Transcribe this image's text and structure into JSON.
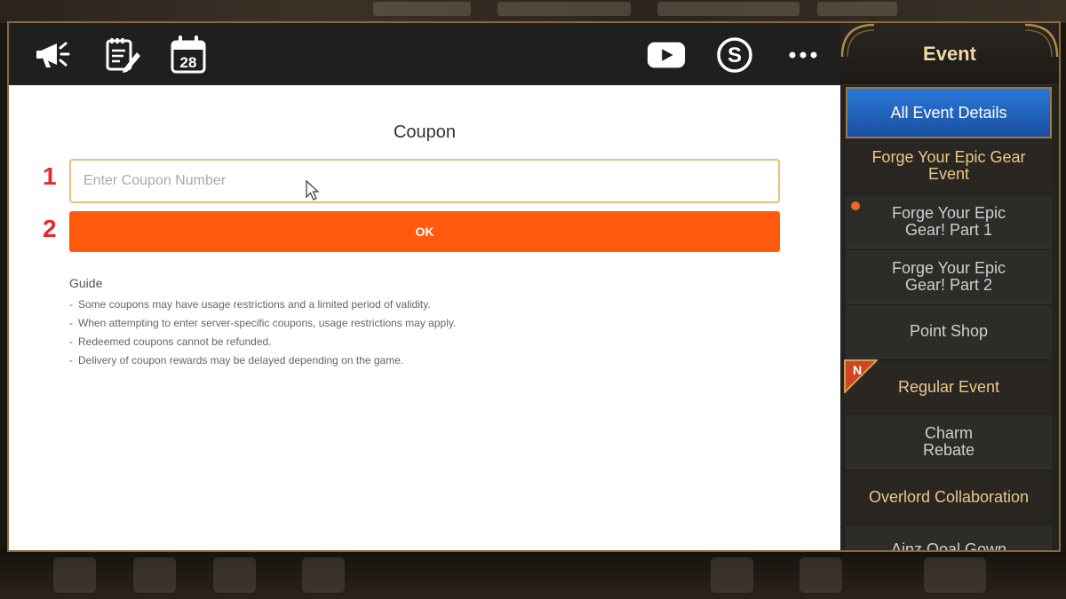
{
  "toolbar": {
    "icons": [
      "megaphone-icon",
      "notepad-icon",
      "calendar-icon",
      "youtube-icon",
      "s-logo-icon",
      "more-icon"
    ],
    "calendar_day": "28"
  },
  "coupon": {
    "title": "Coupon",
    "input_placeholder": "Enter Coupon Number",
    "input_value": "",
    "ok_label": "OK",
    "annotations": [
      "1",
      "2"
    ],
    "guide_title": "Guide",
    "guide_items": [
      "Some coupons may have usage restrictions and a limited period of validity.",
      "When attempting to enter server-specific coupons, usage restrictions may apply.",
      "Redeemed coupons cannot be refunded.",
      "Delivery of coupon rewards may be delayed depending on the game."
    ],
    "colors": {
      "ok_button": "#ff5a0e",
      "annotation": "#e5282c",
      "input_border": "#e3c27a"
    }
  },
  "sidebar": {
    "title": "Event",
    "items": [
      {
        "label": "All Event Details",
        "type": "active"
      },
      {
        "label": "Forge Your Epic Gear Event",
        "type": "category"
      },
      {
        "label": "Forge Your Epic Gear! Part 1",
        "type": "sub",
        "dot": true
      },
      {
        "label": "Forge Your Epic Gear! Part 2",
        "type": "sub"
      },
      {
        "label": "Point Shop",
        "type": "sub"
      },
      {
        "label": "Regular Event",
        "type": "category",
        "badge": "N"
      },
      {
        "label": "Charm Rebate",
        "type": "sub"
      },
      {
        "label": "Overlord Collaboration",
        "type": "category"
      },
      {
        "label": "Ainz Ooal Gown",
        "type": "sub"
      }
    ],
    "colors": {
      "active": "#2a78d8",
      "category_text": "#e9c88a"
    }
  }
}
